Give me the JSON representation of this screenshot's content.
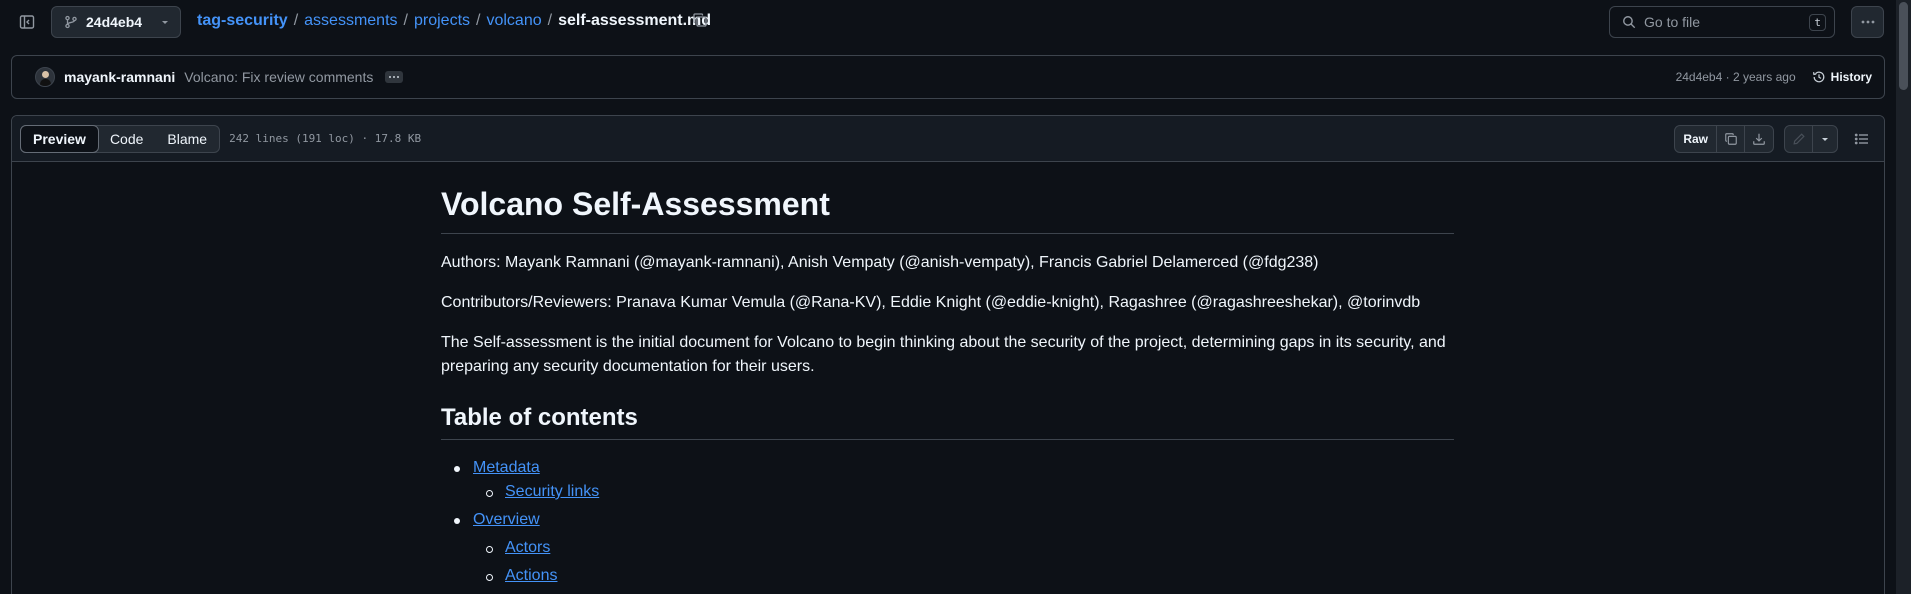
{
  "topbar": {
    "branch": "24d4eb4",
    "breadcrumb": {
      "repo": "tag-security",
      "parts": [
        "assessments",
        "projects",
        "volcano"
      ],
      "current": "self-assessment.md"
    },
    "goto": {
      "placeholder": "Go to file",
      "shortcut": "t"
    }
  },
  "commit": {
    "author": "mayank-ramnani",
    "message": "Volcano: Fix review comments",
    "meta": "24d4eb4 · 2 years ago",
    "history_label": "History"
  },
  "file": {
    "tabs": [
      "Preview",
      "Code",
      "Blame"
    ],
    "active_tab": "Preview",
    "info": "242 lines (191 loc) · 17.8 KB",
    "raw_label": "Raw"
  },
  "markdown": {
    "title": "Volcano Self-Assessment",
    "authors": "Authors: Mayank Ramnani (@mayank-ramnani), Anish Vempaty (@anish-vempaty), Francis Gabriel Delamerced (@fdg238)",
    "contributors": "Contributors/Reviewers: Pranava Kumar Vemula (@Rana-KV), Eddie Knight (@eddie-knight), Ragashree (@ragashreeshekar), @torinvdb",
    "intro": "The Self-assessment is the initial document for Volcano to begin thinking about the security of the project, determining gaps in its security, and preparing any security documentation for their users.",
    "toc_heading": "Table of contents",
    "toc": [
      "Metadata",
      "Security links",
      "Overview",
      "Actors",
      "Actions"
    ]
  }
}
